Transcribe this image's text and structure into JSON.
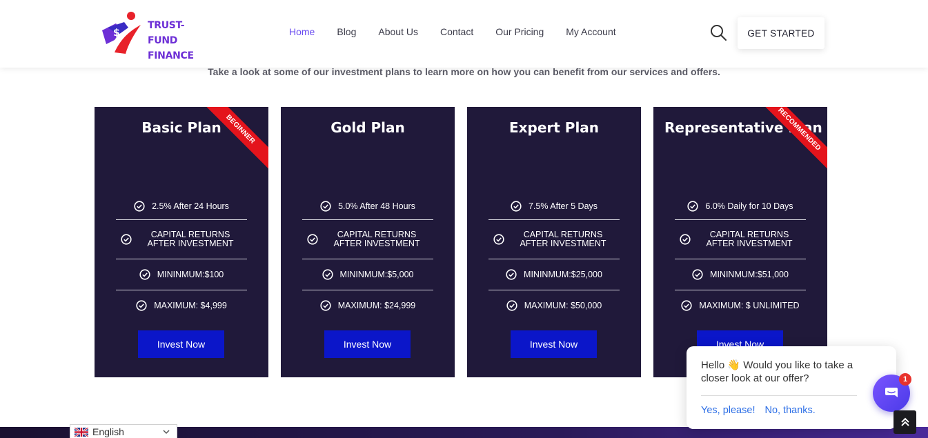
{
  "brand": {
    "line1": "TRUST-FUND",
    "line2": "FINANCE"
  },
  "nav": [
    {
      "label": "Home",
      "active": true
    },
    {
      "label": "Blog"
    },
    {
      "label": "About Us"
    },
    {
      "label": "Contact"
    },
    {
      "label": "Our Pricing"
    },
    {
      "label": "My Account"
    }
  ],
  "header": {
    "cta_label": "GET STARTED"
  },
  "intro": "Take a look at some of our investment plans to learn more on how you can benefit from our services and offers.",
  "plans": [
    {
      "title": "Basic Plan",
      "ribbon": "BEGINNER",
      "features": [
        "2.5% After 24 Hours",
        "CAPITAL RETURNS AFTER INVESTMENT",
        "MININMUM:$100",
        "MAXIMUM: $4,999"
      ],
      "button": "Invest Now"
    },
    {
      "title": "Gold Plan",
      "ribbon": "",
      "features": [
        "5.0% After 48 Hours",
        "CAPITAL RETURNS AFTER INVESTMENT",
        "MININMUM:$5,000",
        "MAXIMUM: $24,999"
      ],
      "button": "Invest Now"
    },
    {
      "title": "Expert Plan",
      "ribbon": "",
      "features": [
        "7.5% After 5 Days",
        "CAPITAL RETURNS AFTER INVESTMENT",
        "MININMUM:$25,000",
        "MAXIMUM: $50,000"
      ],
      "button": "Invest Now"
    },
    {
      "title": "Representative Plan",
      "ribbon": "RECOMMENDED",
      "features": [
        "6.0% Daily for 10 Days",
        "CAPITAL RETURNS AFTER INVESTMENT",
        "MININMUM:$51,000",
        "MAXIMUM: $ UNLIMITED"
      ],
      "button": "Invest Now"
    }
  ],
  "language": {
    "selected": "English"
  },
  "chat": {
    "message": "Hello 👋 Would you like to take a closer look at our offer?",
    "yes": "Yes, please!",
    "no": "No, thanks.",
    "badge": "1"
  },
  "colors": {
    "accent": "#6a4cf0",
    "card_bg": "#20193a",
    "button": "#0b16c9",
    "ribbon": "#e4141c"
  }
}
